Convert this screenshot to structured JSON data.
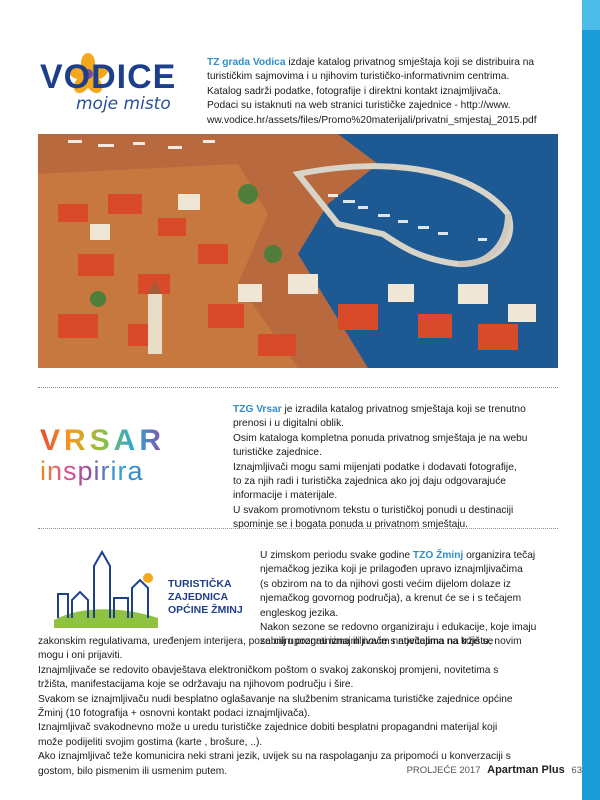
{
  "vodice": {
    "logo_word": "VODICE",
    "logo_sub": "moje misto",
    "org": "TZ grada Vodica",
    "line1_rest": " izdaje katalog privatnog smještaja koji se distribuira na",
    "line2": "turističkim sajmovima i u njihovim turističko-informativnim centrima.",
    "line3": "Katalog sadrži podatke, fotografije i direktni kontakt iznajmljivača.",
    "line4": "Podaci su istaknuti na web stranici turističke zajednice - http://www.",
    "line5": "ww.vodice.hr/assets/files/Promo%20materijali/privatni_smjestaj_2015.pdf"
  },
  "vrsar": {
    "logo_word": "VRSAR",
    "logo_sub": "inspirira",
    "org": "TZG Vrsar",
    "lines": [
      " je izradila katalog privatnog smještaja  koji se trenutno",
      "prenosi i u digitalni oblik.",
      "Osim kataloga kompletna ponuda privatnog smještaja je na webu",
      "turističke zajednice.",
      "Iznajmljivači mogu sami mijenjati podatke i dodavati fotografije,",
      "to za njih radi i turistička zajednica  ako joj daju odgovarajuće",
      "informacije i materijale.",
      "U svakom promotivnom tekstu o turističkoj ponudi u destinaciji",
      "spominje se i bogata ponuda u privatnom smještaju."
    ]
  },
  "zminj": {
    "logo_lines": [
      "TURISTIČKA",
      "ZAJEDNICA",
      "OPĆINE ŽMINJ"
    ],
    "intro_before": "U zimskom periodu svake godine ",
    "org": "TZO Žminj",
    "intro_after": " organizira tečaj",
    "lines_right": [
      "njemačkog jezika koji je prilagođen upravo iznajmljivačima",
      "(s obzirom na to da njihovi gosti većim dijelom dolaze iz",
      "njemačkog govornog područja), a krenut će se i s tečajem",
      "engleskog jezika.",
      "Nakon sezone se redovno organiziraju i edukacije, koje imaju",
      "za cilj upoznati iznajmljivače s novitetima na tržištu, novim"
    ],
    "lines_full": [
      "zakonskim regulativama, uređenjem interijera, posebnim programima ili novim natječajima na koje se",
      "mogu i oni prijaviti.",
      "Iznajmljivače se redovito obavještava elektroničkom poštom o svakoj zakonskoj promjeni, novitetima s",
      "tržišta, manifestacijama koje se održavaju na njihovom području i šire.",
      "Svakom se iznajmljivaču nudi besplatno oglašavanje na službenim stranicama turističke zajednice općine",
      "Žminj (10 fotografija + osnovni kontakt podaci iznajmljivača).",
      "Iznajmljivač svakodnevno može u uredu turističke zajednice dobiti besplatni propagandni materijal koji",
      "može podijeliti svojim gostima (karte , brošure, ..).",
      "Ako iznajmljivač teže komunicira neki strani jezik, uvijek su na raspolaganju za pripomoći u konverzaciji s",
      "gostom, bilo pismenim ili usmenim putem."
    ]
  },
  "footer": {
    "season": "PROLJEĆE 2017",
    "magazine": "Apartman Plus",
    "page": "63"
  },
  "colors": {
    "accent": "#2f8fc9",
    "sidebar": "#1b9bd7"
  }
}
